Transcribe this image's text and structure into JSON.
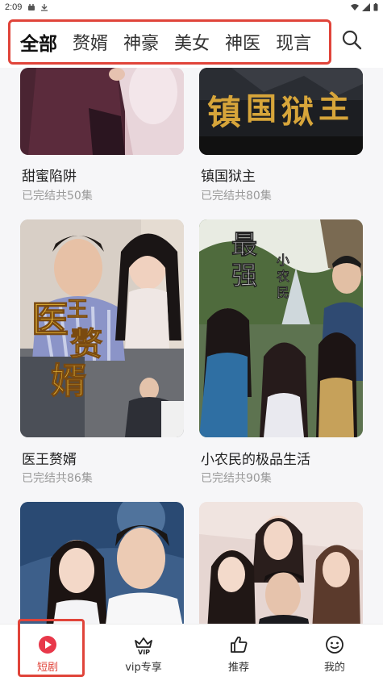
{
  "status_bar": {
    "time": "2:09"
  },
  "tabs": [
    {
      "label": "全部",
      "active": true
    },
    {
      "label": "赘婿",
      "active": false
    },
    {
      "label": "神豪",
      "active": false
    },
    {
      "label": "美女",
      "active": false
    },
    {
      "label": "神医",
      "active": false
    },
    {
      "label": "现言",
      "active": false
    }
  ],
  "search": {
    "icon": "search-icon"
  },
  "dramas": [
    {
      "title": "甜蜜陷阱",
      "status": "已完结共50集",
      "poster_text": ""
    },
    {
      "title": "镇国狱主",
      "status": "已完结共80集",
      "poster_text": "镇国狱主"
    },
    {
      "title": "医王赘婿",
      "status": "已完结共86集",
      "poster_text": "医王赘婿"
    },
    {
      "title": "小农民的极品生活",
      "status": "已完结共90集",
      "poster_text": "最强小农民"
    },
    {
      "title": "",
      "status": "",
      "poster_text": ""
    },
    {
      "title": "",
      "status": "",
      "poster_text": ""
    }
  ],
  "poster_art": {
    "p2_title_1": "镇",
    "p2_title_2": "国",
    "p2_title_3": "狱",
    "p2_title_4": "主",
    "p3_title_1": "医",
    "p3_title_2": "王",
    "p3_title_3": "赘",
    "p3_title_4": "婿",
    "p4_title_1": "最",
    "p4_title_2": "强",
    "p4_sub_1": "小",
    "p4_sub_2": "农",
    "p4_sub_3": "民"
  },
  "bottom_nav": [
    {
      "label": "短剧",
      "icon": "play-circle-icon",
      "active": true
    },
    {
      "label": "vip专享",
      "icon": "vip-crown-icon",
      "active": false
    },
    {
      "label": "推荐",
      "icon": "thumbs-up-icon",
      "active": false
    },
    {
      "label": "我的",
      "icon": "smiley-face-icon",
      "active": false
    }
  ],
  "colors": {
    "accent": "#e0443a",
    "muted_text": "#999999",
    "title_text": "#222222"
  }
}
